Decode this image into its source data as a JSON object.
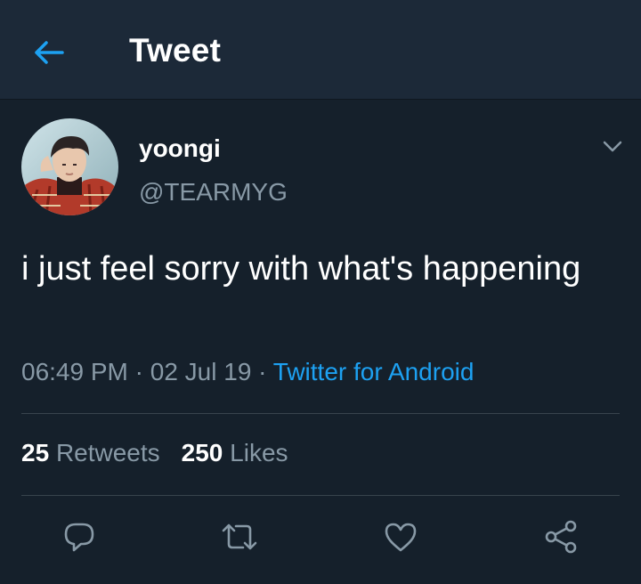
{
  "header": {
    "title": "Tweet",
    "back_icon": "arrow-left-icon",
    "back_color": "#1da1f2"
  },
  "tweet": {
    "display_name": "yoongi",
    "handle": "@TEARMYG",
    "text": "i just feel sorry with what's happening",
    "time": "06:49 PM",
    "date": "02 Jul 19",
    "separator": "·",
    "source": "Twitter for Android",
    "menu_icon": "chevron-down-icon"
  },
  "stats": {
    "retweets_count": "25",
    "retweets_label": "Retweets",
    "likes_count": "250",
    "likes_label": "Likes"
  },
  "actions": [
    {
      "icon": "reply-icon"
    },
    {
      "icon": "retweet-icon"
    },
    {
      "icon": "like-icon"
    },
    {
      "icon": "share-icon"
    }
  ],
  "colors": {
    "background": "#15202b",
    "header_background": "#1c2938",
    "accent": "#1da1f2",
    "secondary_text": "#8899a6",
    "divider": "#38444d"
  }
}
